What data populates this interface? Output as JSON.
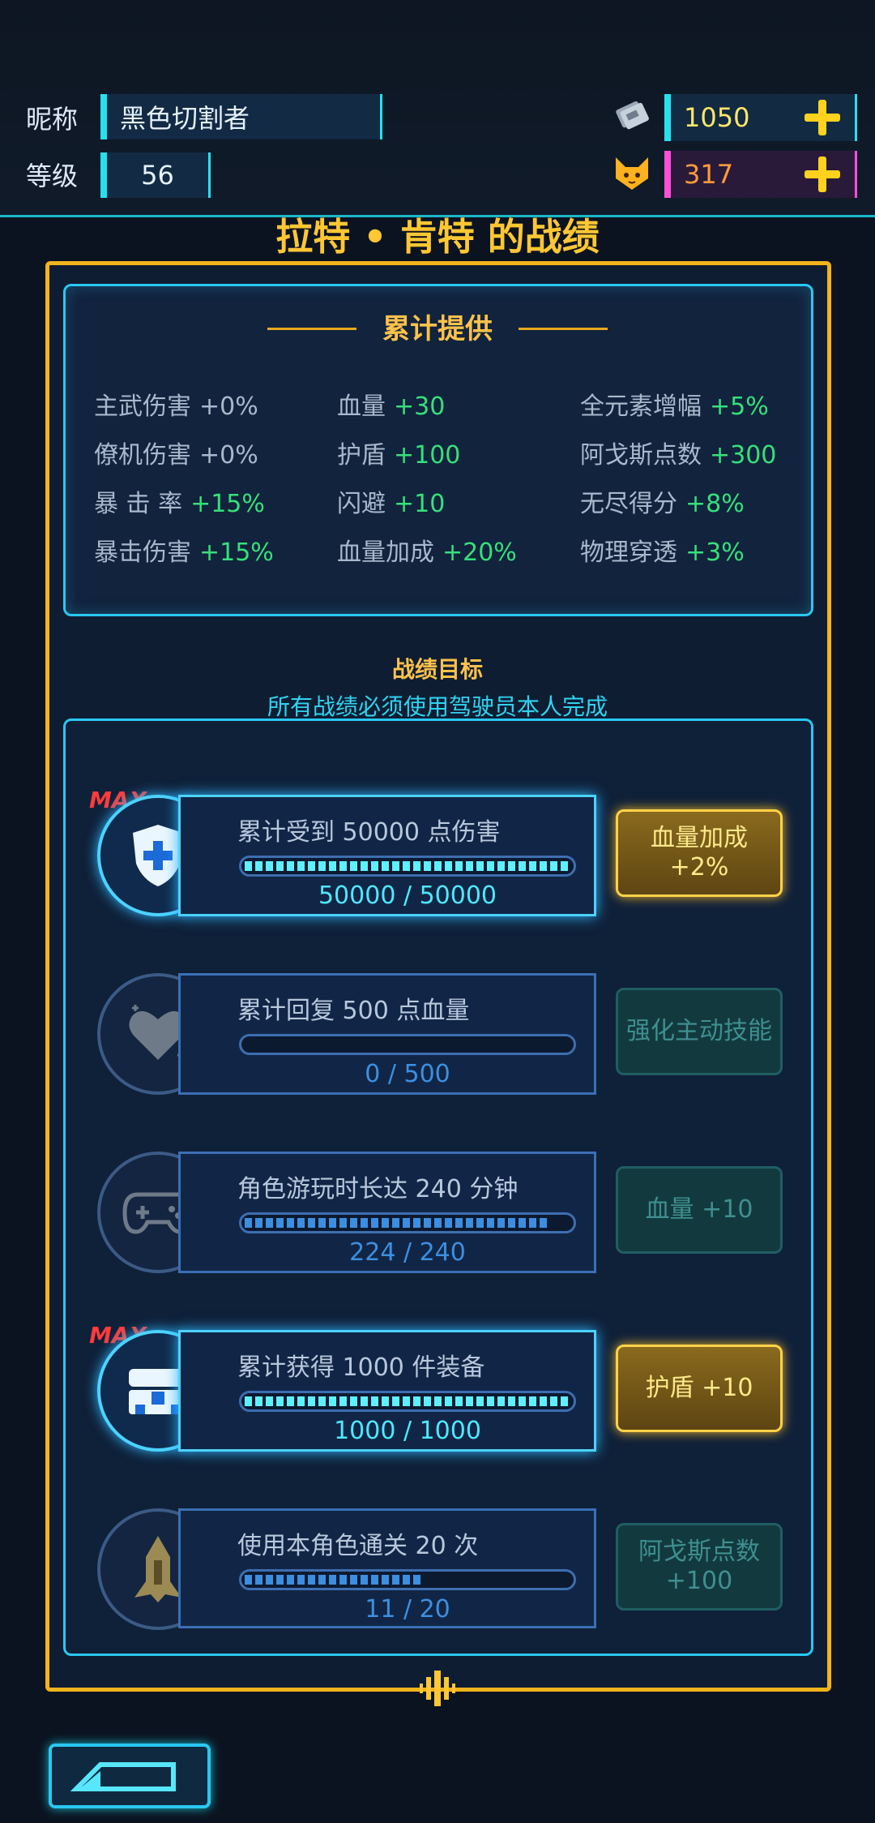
{
  "header": {
    "nickname_label": "昵称",
    "nickname_value": "黑色切割者",
    "level_label": "等级",
    "level_value": "56",
    "gems": "1050",
    "cat_points": "317"
  },
  "title": "拉特 • 肯特 的战绩",
  "provided": {
    "title": "累计提供",
    "stats": [
      {
        "label": "主武伤害",
        "value": "+0%"
      },
      {
        "label": "僚机伤害",
        "value": "+0%"
      },
      {
        "label": "暴 击 率",
        "value": "+15%"
      },
      {
        "label": "暴击伤害",
        "value": "+15%"
      },
      {
        "label": "血量",
        "value": "+30"
      },
      {
        "label": "护盾",
        "value": "+100"
      },
      {
        "label": "闪避",
        "value": "+10"
      },
      {
        "label": "血量加成",
        "value": "+20%"
      },
      {
        "label": "全元素增幅",
        "value": "+5%"
      },
      {
        "label": "阿戈斯点数",
        "value": "+300"
      },
      {
        "label": "无尽得分",
        "value": "+8%"
      },
      {
        "label": "物理穿透",
        "value": "+3%"
      }
    ]
  },
  "goals": {
    "title": "战绩目标",
    "subtitle": "所有战绩必须使用驾驶员本人完成",
    "max_tag": "MAX",
    "items": [
      {
        "text": "累计受到 50000 点伤害",
        "progress": "50000 / 50000",
        "fraction": 1.0,
        "reward": "血量加成\n+2%",
        "done": true,
        "icon": "shield-plus-icon"
      },
      {
        "text": "累计回复 500 点血量",
        "progress": "0 / 500",
        "fraction": 0.0,
        "reward": "强化主动技能",
        "done": false,
        "icon": "heart-icon"
      },
      {
        "text": "角色游玩时长达 240 分钟",
        "progress": "224 / 240",
        "fraction": 0.933,
        "reward": "血量 +10",
        "done": false,
        "icon": "gamepad-icon"
      },
      {
        "text": "累计获得 1000 件装备",
        "progress": "1000 / 1000",
        "fraction": 1.0,
        "reward": "护盾 +10",
        "done": true,
        "icon": "chest-icon"
      },
      {
        "text": "使用本角色通关 20 次",
        "progress": "11 / 20",
        "fraction": 0.55,
        "reward": "阿戈斯点数\n+100",
        "done": false,
        "icon": "ship-icon"
      }
    ]
  }
}
